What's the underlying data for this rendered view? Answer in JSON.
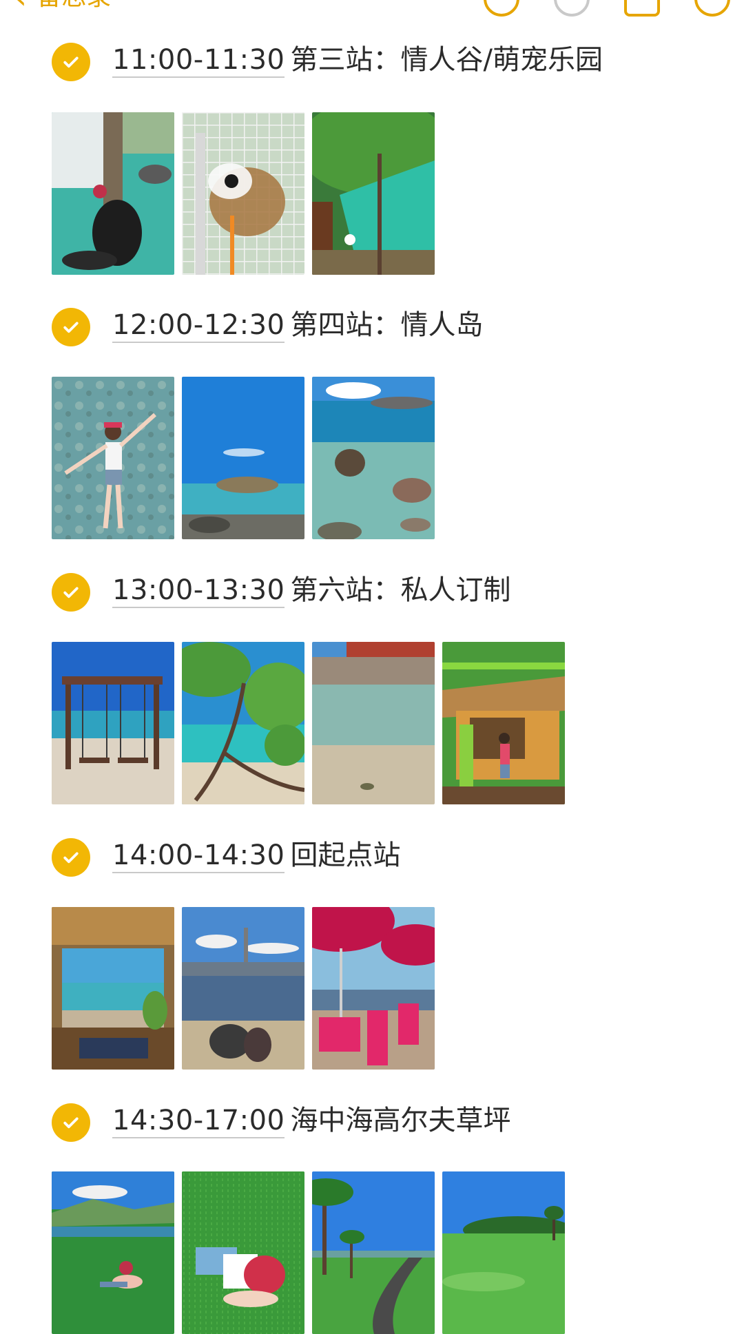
{
  "header": {
    "back_label": "备忘录",
    "back_icon": "chevron-left-icon"
  },
  "items": [
    {
      "time": "11:00-11:30",
      "title": "第三站：情人谷/萌宠乐园",
      "checked": true
    },
    {
      "time": "12:00-12:30",
      "title": "第四站：情人岛",
      "checked": true
    },
    {
      "time": "13:00-13:30",
      "title": "第六站：私人订制",
      "checked": true
    },
    {
      "time": "14:00-14:30",
      "title": "回起点站",
      "checked": true
    },
    {
      "time": "14:30-17:00",
      "title": "海中海高尔夫草坪",
      "checked": true
    }
  ],
  "colors": {
    "accent": "#f2b705",
    "text": "#2b2b2b"
  }
}
